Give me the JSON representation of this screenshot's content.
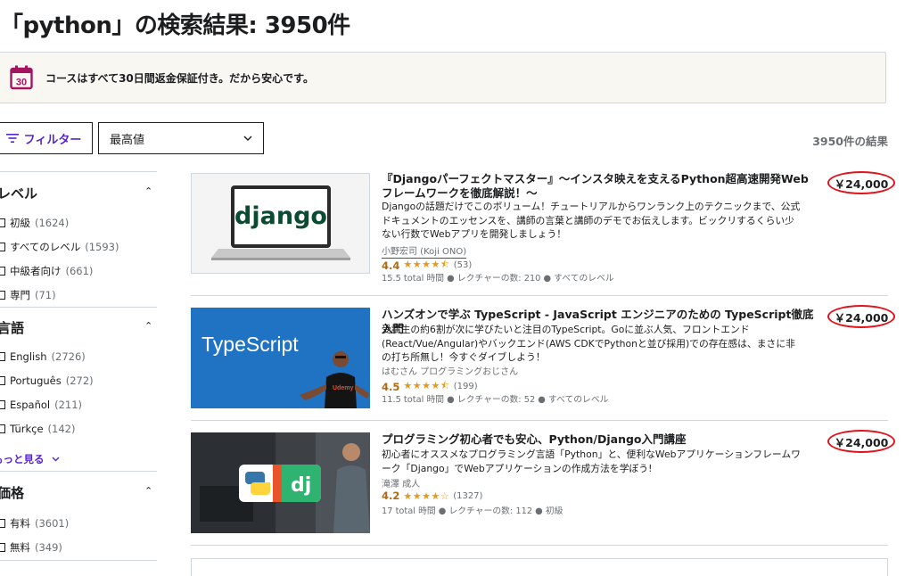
{
  "page_title": "「python」の検索結果: 3950件",
  "banner": {
    "text": "コースはすべて30日間返金保証付き。だから安心です。",
    "icon": "calendar-30-icon",
    "icon_text": "30",
    "icon_color": "#a3155e"
  },
  "toolbar": {
    "filter_label": "フィルター",
    "sort_value": "最高値",
    "result_count": "3950件の結果"
  },
  "sidebar": {
    "level": {
      "title": "レベル",
      "options": [
        {
          "label": "初級",
          "count": "(1624)"
        },
        {
          "label": "すべてのレベル",
          "count": "(1593)"
        },
        {
          "label": "中級者向け",
          "count": "(661)"
        },
        {
          "label": "専門",
          "count": "(71)"
        }
      ]
    },
    "language": {
      "title": "言語",
      "options": [
        {
          "label": "English",
          "count": "(2726)"
        },
        {
          "label": "Português",
          "count": "(272)"
        },
        {
          "label": "Español",
          "count": "(211)"
        },
        {
          "label": "Türkçe",
          "count": "(142)"
        }
      ],
      "show_more": "もっと見る"
    },
    "price": {
      "title": "価格",
      "options": [
        {
          "label": "有料",
          "count": "(3601)"
        },
        {
          "label": "無料",
          "count": "(349)"
        }
      ]
    }
  },
  "courses": [
    {
      "title": "『Djangoパーフェクトマスター』〜インスタ映えを支えるPython超高速開発Webフレームワークを徹底解説！〜",
      "description": "Djangoの話題だけでこのボリューム！チュートリアルからワンランク上のテクニックまで、公式ドキュメントのエッセンスを、講師の言葉と講師のデモでお伝えします。ビックリするくらい少ない行数でWebアプリを開発しましょう！",
      "instructor": "小野宏司 (Koji ONO)",
      "rating": "4.4",
      "stars": 4.4,
      "reviews": "(53)",
      "meta": "15.5 total 時間 ● レクチャーの数: 210 ● すべてのレベル",
      "price": "￥24,000",
      "thumb_text": "django"
    },
    {
      "title": "ハンズオンで学ぶ TypeScript - JavaScript エンジニアのための TypeScript徹底入門",
      "description": "受講生の約6割が次に学びたいと注目のTypeScript。Goに並ぶ人気、フロントエンド(React/Vue/Angular)やバックエンド(AWS CDKでPythonと並び採用)での存在感は、まさに非の打ち所無し！今すぐダイブしよう！",
      "instructor": "はむさん プログラミングおじさん",
      "rating": "4.5",
      "stars": 4.5,
      "reviews": "(199)",
      "meta": "11.5 total 時間 ● レクチャーの数: 52 ● すべてのレベル",
      "price": "￥24,000",
      "thumb_text": "TypeScript",
      "thumb_badge": "Udemy"
    },
    {
      "title": "プログラミング初心者でも安心、Python/Django入門講座",
      "description": "初心者にオススメなプログラミング言語「Python」と、便利なWebアプリケーションフレームワーク「Django」でWebアプリケーションの作成方法を学ぼう!",
      "instructor": "滝澤 成人",
      "rating": "4.2",
      "stars": 4.2,
      "reviews": "(1327)",
      "meta": "17 total 時間 ● レクチャーの数: 112 ● 初級",
      "price": "￥24,000",
      "thumb_text": "dj"
    }
  ],
  "colors": {
    "accent": "#5624d0",
    "rating": "#b4690e",
    "stars": "#e59819",
    "price_circle": "#e0121b",
    "typescript_blue": "#1f73c2"
  }
}
